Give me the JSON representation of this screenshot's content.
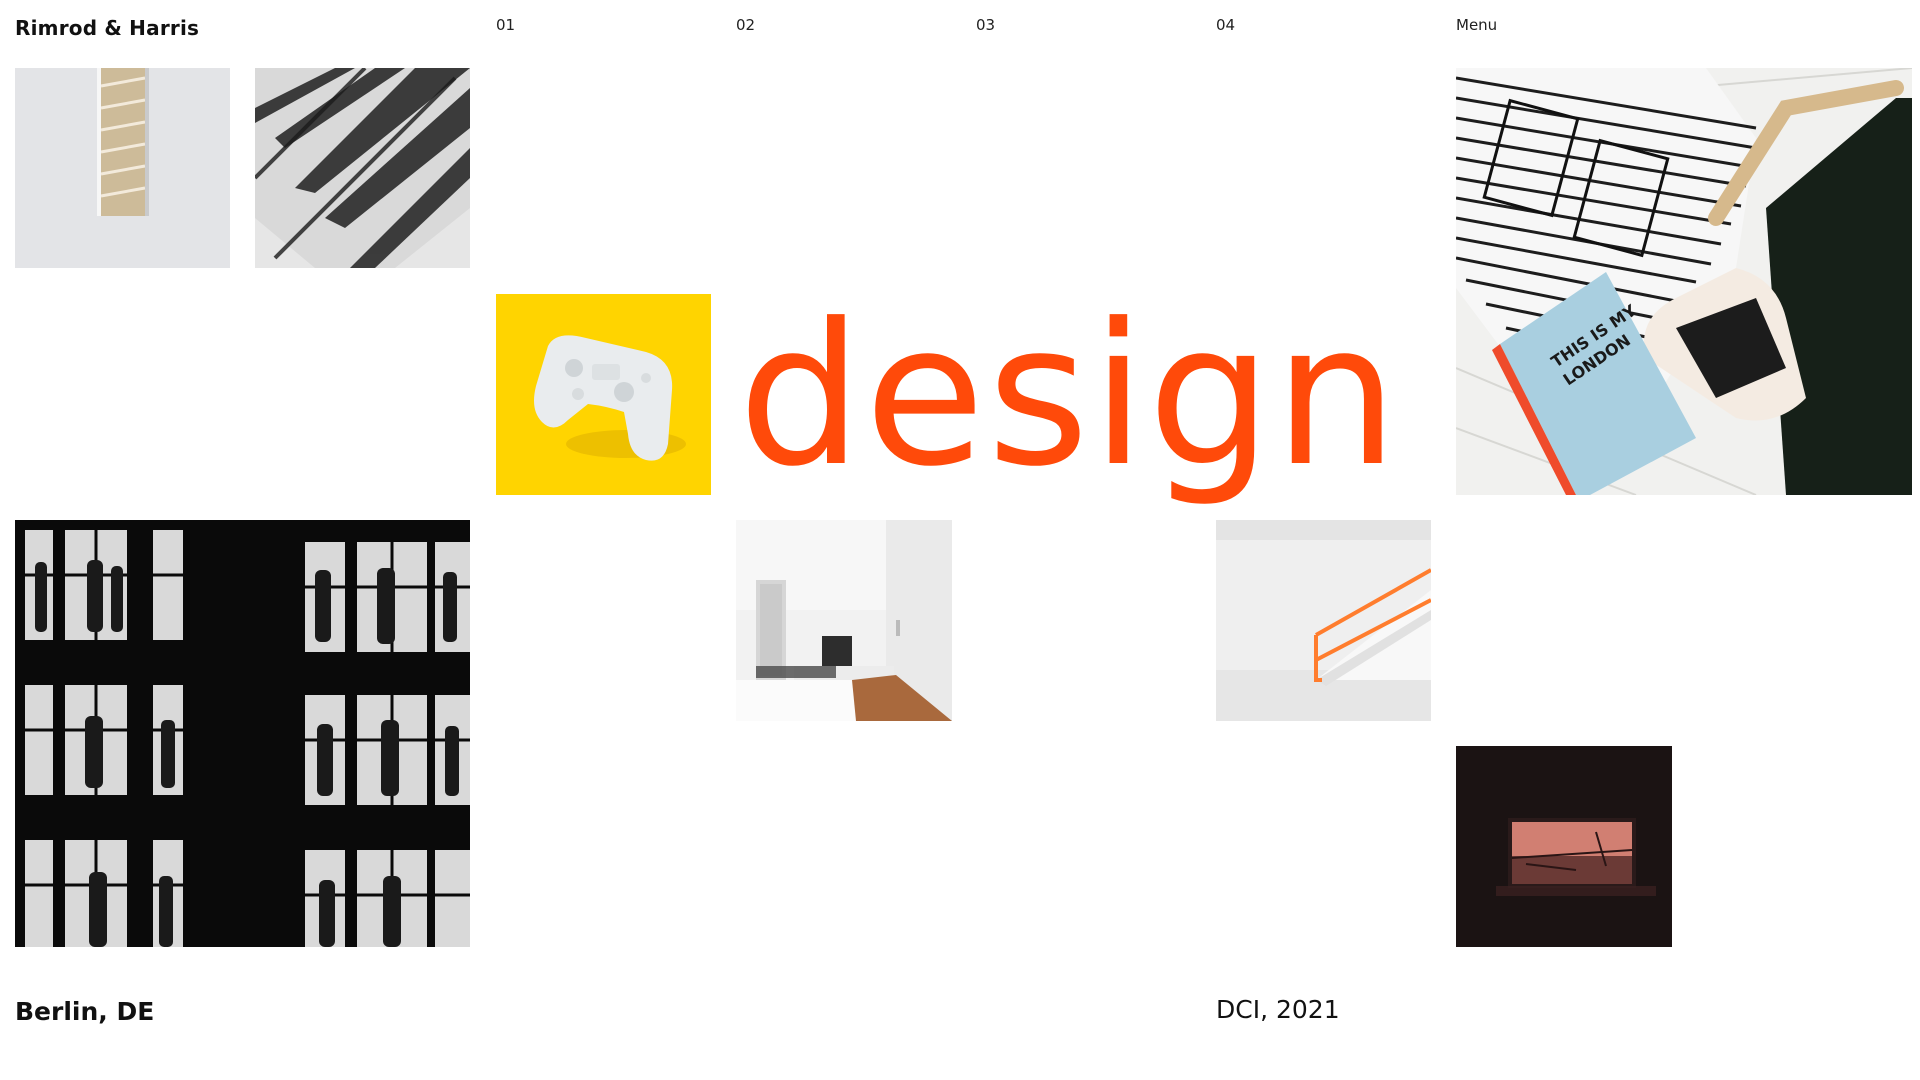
{
  "header": {
    "brand": "Rimrod & Harris",
    "nav": [
      {
        "label": "01"
      },
      {
        "label": "02"
      },
      {
        "label": "03"
      },
      {
        "label": "04"
      }
    ],
    "menu_label": "Menu"
  },
  "hero": {
    "word": "design"
  },
  "footer": {
    "location": "Berlin, DE",
    "credit": "DCI, 2021"
  },
  "book": {
    "cover_text_line1": "THIS IS MY",
    "cover_text_line2": "LONDON"
  },
  "colors": {
    "accent": "#ff4a0a",
    "yellow": "#ffd400"
  }
}
